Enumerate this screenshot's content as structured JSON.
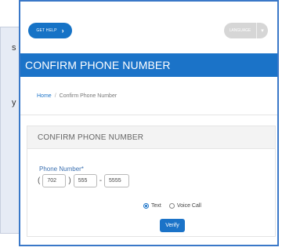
{
  "side_text": [
    "s",
    "y"
  ],
  "header": {
    "help_label": "GET HELP",
    "help_icon": "chevron-right-icon",
    "language_label": "LANGUAGE",
    "language_icon": "caret-down-icon"
  },
  "title": "CONFIRM PHONE NUMBER",
  "breadcrumb": {
    "home": "Home",
    "separator": "/",
    "current": "Confirm Phone Number"
  },
  "card": {
    "heading": "CONFIRM PHONE NUMBER",
    "phone_label": "Phone Number*",
    "open_paren": "(",
    "close_paren": ")",
    "dash": "-",
    "area_code": "702",
    "prefix": "555",
    "line": "5555",
    "options": [
      {
        "label": "Text",
        "selected": true
      },
      {
        "label": "Voice Call",
        "selected": false
      }
    ],
    "verify_label": "Verify"
  },
  "colors": {
    "accent": "#1b73c8",
    "frame_border": "#3a78c8",
    "side_panel": "#e6ebf5"
  }
}
